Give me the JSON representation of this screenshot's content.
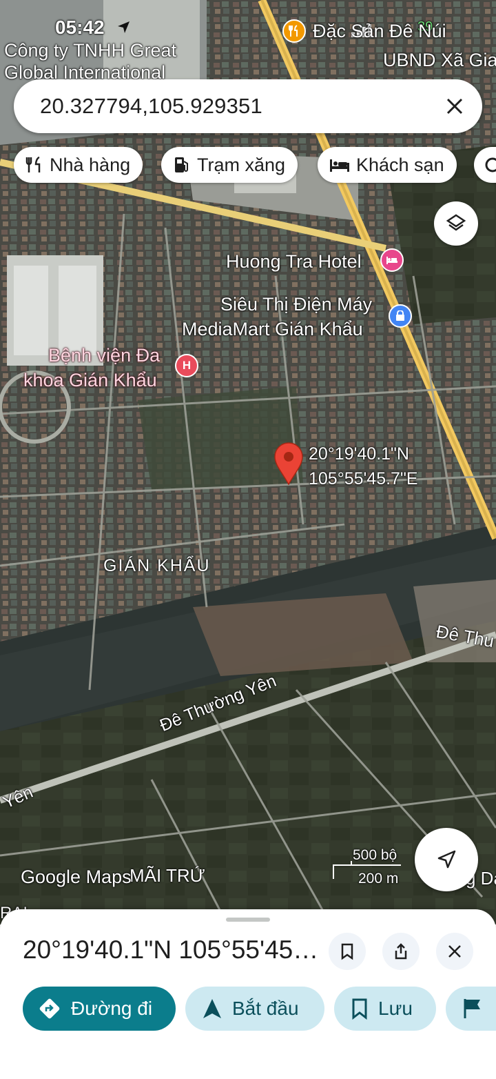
{
  "status": {
    "time": "05:42",
    "poi_top": "Đặc Sản Đê Núi",
    "signal_text": "39"
  },
  "search": {
    "query": "20.327794,105.929351",
    "clear_label": "×"
  },
  "chips": [
    {
      "label": "Nhà hàng",
      "icon": "restaurant-icon"
    },
    {
      "label": "Trạm xăng",
      "icon": "gas-station-icon"
    },
    {
      "label": "Khách sạn",
      "icon": "hotel-icon"
    }
  ],
  "map": {
    "labels": {
      "company": "Công ty TNHH Great Global International",
      "company_line1": "Công ty TNHH Great",
      "company_line2": "Global International",
      "commune": "UBND Xã Gia",
      "hotel": "Huong Tra Hotel",
      "mart_line1": "Siêu Thị Điện Máy",
      "mart_line2": "MediaMart Gián Khẩu",
      "hospital_line1": "Bệnh viện Đa",
      "hospital_line2": "khoa Gián Khẩu",
      "area": "GIÁN KHẨU",
      "dyke": "Đê Thường Yên",
      "dyke_right": "Đê Thu",
      "yen": "Yên",
      "mai_tru": "MÃI TRỨ",
      "edge_right": "g Dá",
      "edge_left": "RAI"
    },
    "pin": {
      "lat": "20°19'40.1\"N",
      "lng": "105°55'45.7\"E"
    },
    "scale": {
      "imperial": "500 bộ",
      "metric": "200 m"
    },
    "attribution": "Google Maps",
    "colors": {
      "pin": "#ea4335",
      "hotel_poi": "#e8468b",
      "shop_poi": "#4285f4",
      "food_poi": "#f29900",
      "road": "#f2c960"
    }
  },
  "sheet": {
    "title": "20°19'40.1\"N 105°55'45.7\"E",
    "actions": [
      {
        "label": "Đường đi",
        "icon": "directions-icon"
      },
      {
        "label": "Bắt đầu",
        "icon": "navigation-arrow-icon"
      },
      {
        "label": "Lưu",
        "icon": "bookmark-icon"
      }
    ]
  }
}
